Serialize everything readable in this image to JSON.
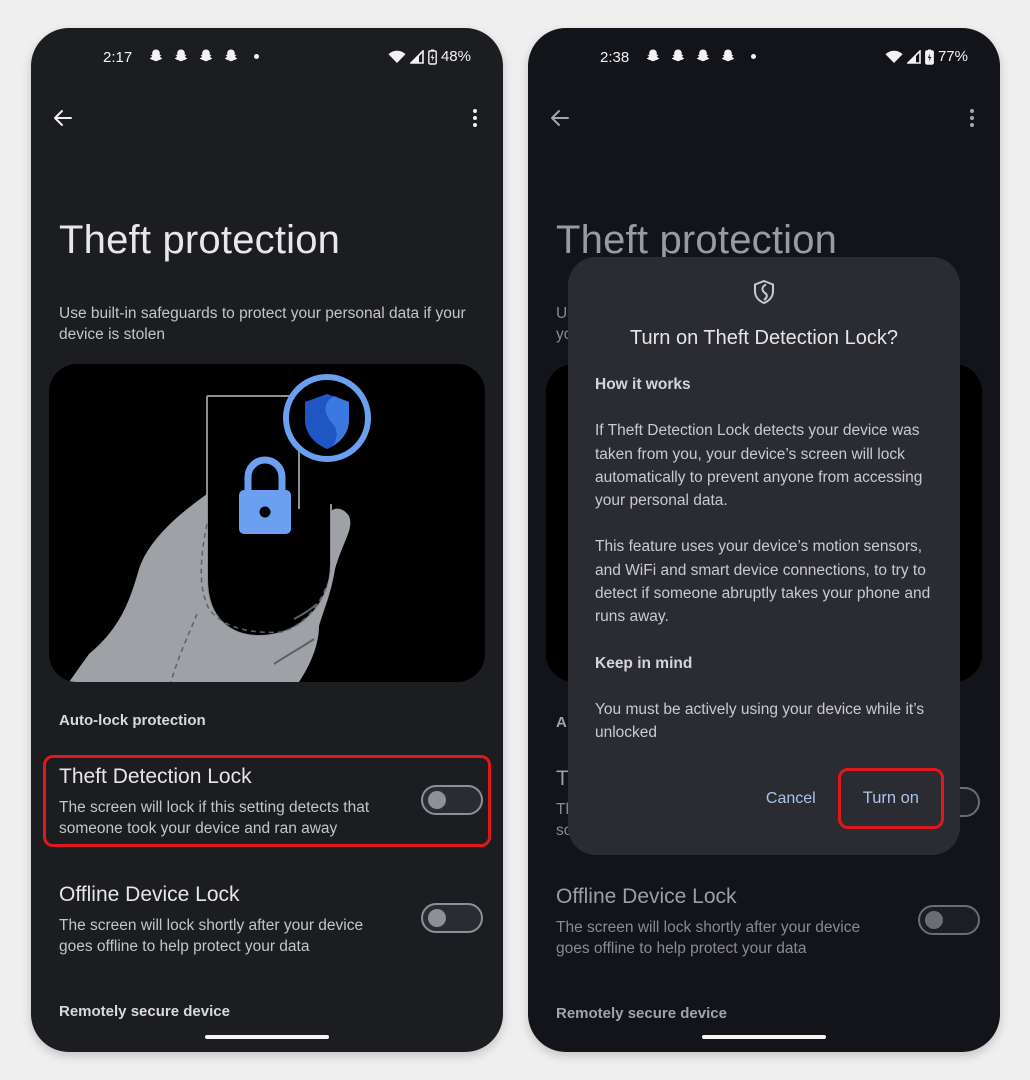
{
  "screens": [
    {
      "status": {
        "time": "2:17",
        "battery": "48%",
        "notification_icons": [
          "snapchat-icon",
          "snapchat-icon",
          "snapchat-icon",
          "snapchat-icon"
        ]
      },
      "page": {
        "title": "Theft protection",
        "description": "Use built-in safeguards to protect your personal data if your device is stolen",
        "section_autolock": "Auto-lock protection",
        "section_remote": "Remotely secure device"
      },
      "settings": [
        {
          "title": "Theft Detection Lock",
          "description": "The screen will lock if this setting detects that someone took your device and ran away",
          "enabled": false,
          "highlighted": true
        },
        {
          "title": "Offline Device Lock",
          "description": "The screen will lock shortly after your device goes offline to help protect your data",
          "enabled": false,
          "highlighted": false
        }
      ]
    },
    {
      "status": {
        "time": "2:38",
        "battery": "77%",
        "notification_icons": [
          "snapchat-icon",
          "snapchat-icon",
          "snapchat-icon",
          "snapchat-icon"
        ]
      },
      "page": {
        "title": "Theft protection",
        "description_partial": "Us\nyo",
        "section_autolock_partial": "A",
        "section_remote": "Remotely secure device"
      },
      "settings": [
        {
          "title_partial": "T",
          "description_partial": "Th\nso",
          "enabled": false
        },
        {
          "title": "Offline Device Lock",
          "description": "The screen will lock shortly after your device goes offline to help protect your data",
          "enabled": false
        }
      ],
      "dialog": {
        "icon": "shield-icon",
        "title": "Turn on Theft Detection Lock?",
        "section1_heading": "How it works",
        "section1_p1": "If Theft Detection Lock detects your device was taken from you, your device’s screen will lock automatically to prevent anyone from accessing your personal data.",
        "section1_p2": "This feature uses your device’s motion sensors, and WiFi and smart device connections, to try to detect if someone abruptly takes your phone and runs away.",
        "section2_heading": "Keep in mind",
        "section2_p1": "You must be actively using your device while it’s unlocked",
        "cancel_label": "Cancel",
        "confirm_label": "Turn on"
      }
    }
  ],
  "colors": {
    "highlight": "#e0171b",
    "accent_blue": "#6b9ff0",
    "dialog_button": "#a9c3ec"
  }
}
